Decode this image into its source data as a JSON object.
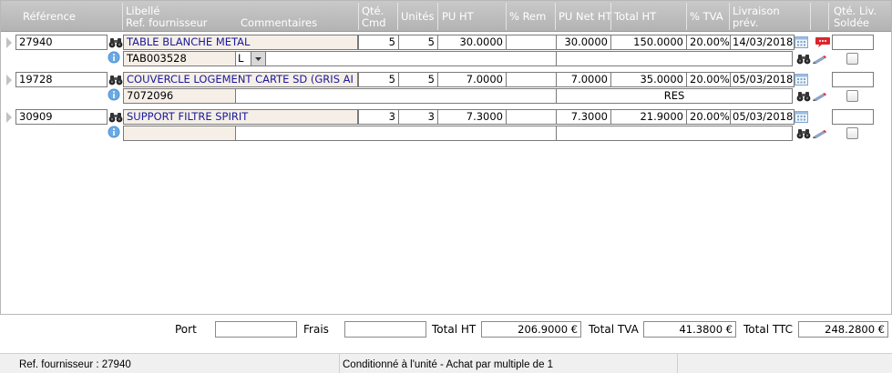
{
  "header": {
    "reference": "Référence",
    "libelle": "Libellé",
    "ref_fournisseur": "Ref. fournisseur",
    "commentaires": "Commentaires",
    "qte_cmd_1": "Qté.",
    "qte_cmd_2": "Cmd",
    "unites": "Unités",
    "pu_ht": "PU HT",
    "rem": "% Rem",
    "pu_net_ht": "PU Net HT",
    "total_ht": "Total HT",
    "tva": "% TVA",
    "livraison_1": "Livraison",
    "livraison_2": "prév.",
    "qte_liv_1": "Qté. Liv.",
    "qte_liv_2": "Soldée"
  },
  "rows": [
    {
      "reference": "27940",
      "libelle": "TABLE BLANCHE METAL",
      "ref_fournisseur": "TAB003528",
      "commentaire": "L",
      "qte": "5",
      "unites": "5",
      "pu_ht": "30.0000",
      "rem": "",
      "pu_net": "30.0000",
      "total": "150.0000",
      "tva": "20.00%",
      "livraison": "14/03/2018",
      "sub_note": "",
      "qte_liv": ""
    },
    {
      "reference": "19728",
      "libelle": "COUVERCLE LOGEMENT CARTE SD (GRIS AI",
      "ref_fournisseur": "7072096",
      "commentaire": "",
      "qte": "5",
      "unites": "5",
      "pu_ht": "7.0000",
      "rem": "",
      "pu_net": "7.0000",
      "total": "35.0000",
      "tva": "20.00%",
      "livraison": "05/03/2018",
      "sub_note": "RES",
      "qte_liv": ""
    },
    {
      "reference": "30909",
      "libelle": "SUPPORT FILTRE SPIRIT",
      "ref_fournisseur": "",
      "commentaire": "",
      "qte": "3",
      "unites": "3",
      "pu_ht": "7.3000",
      "rem": "",
      "pu_net": "7.3000",
      "total": "21.9000",
      "tva": "20.00%",
      "livraison": "05/03/2018",
      "sub_note": "",
      "qte_liv": ""
    }
  ],
  "totals": {
    "port_label": "Port",
    "port_value": "",
    "frais_label": "Frais",
    "frais_value": "",
    "total_ht_label": "Total HT",
    "total_ht_value": "206.9000 €",
    "total_tva_label": "Total TVA",
    "total_tva_value": "41.3800 €",
    "total_ttc_label": "Total TTC",
    "total_ttc_value": "248.2800 €"
  },
  "status": {
    "ref_fournisseur": "Ref. fournisseur : 27940",
    "conditionnement": "Conditionné à l'unité - Achat par multiple de 1"
  },
  "icons": {
    "binoculars": "binoculars-icon",
    "info": "info-icon",
    "calendar": "calendar-icon",
    "comment": "comment-icon",
    "edit": "pencil-icon"
  },
  "colors": {
    "header_bg": "#bdbdbd",
    "libelle_text": "#1a1a9a",
    "info_blue": "#4f93d6",
    "comment_red": "#d9262b"
  }
}
